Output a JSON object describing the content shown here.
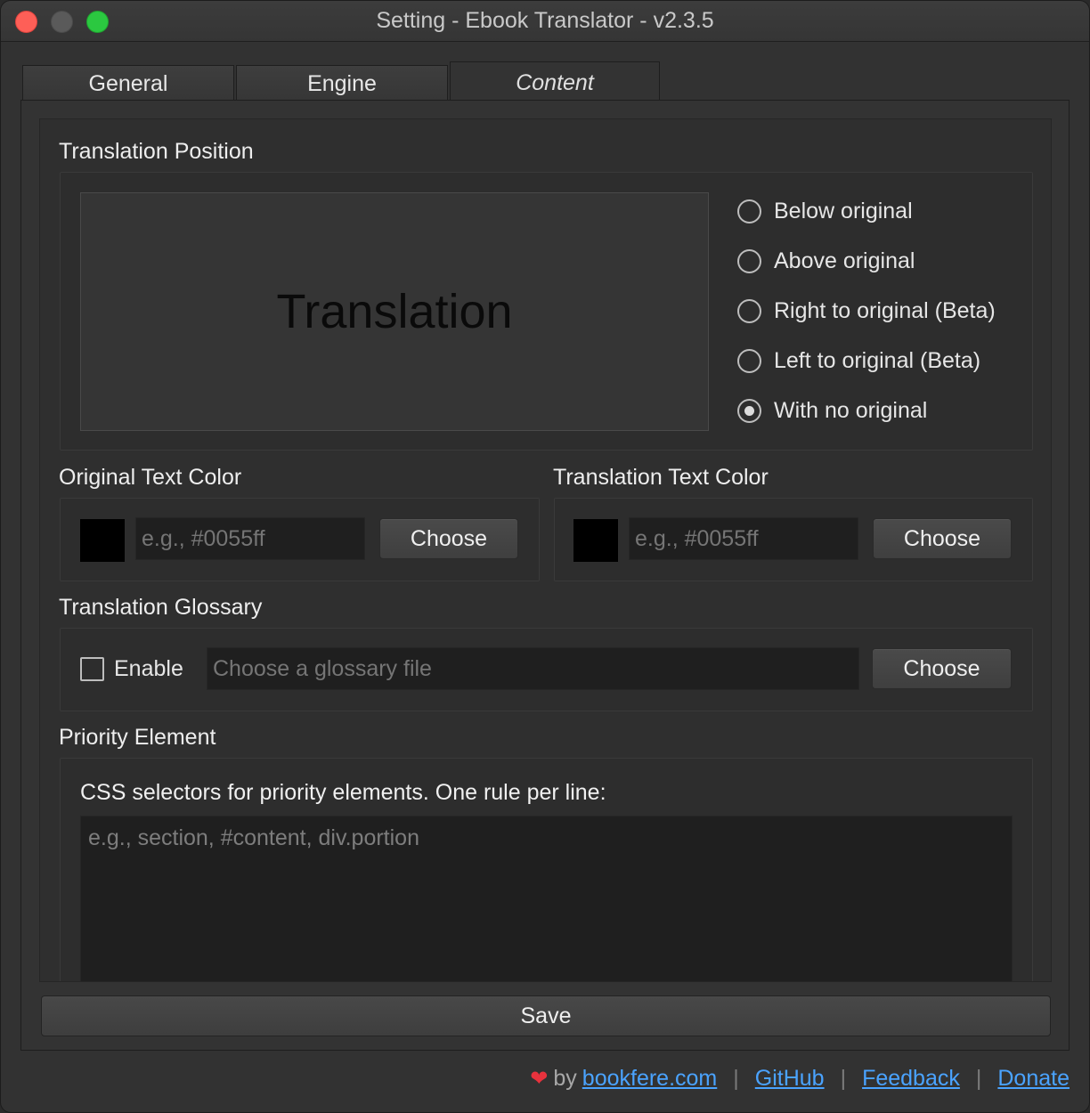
{
  "window": {
    "title": "Setting - Ebook Translator - v2.3.5"
  },
  "tabs": [
    {
      "label": "General",
      "active": false
    },
    {
      "label": "Engine",
      "active": false
    },
    {
      "label": "Content",
      "active": true
    }
  ],
  "translation_position": {
    "heading": "Translation Position",
    "preview_text": "Translation",
    "options": [
      {
        "label": "Below original",
        "checked": false
      },
      {
        "label": "Above original",
        "checked": false
      },
      {
        "label": "Right to original (Beta)",
        "checked": false
      },
      {
        "label": "Left to original (Beta)",
        "checked": false
      },
      {
        "label": "With no original",
        "checked": true
      }
    ]
  },
  "original_color": {
    "heading": "Original Text Color",
    "swatch": "#000000",
    "value": "",
    "placeholder": "e.g., #0055ff",
    "button": "Choose"
  },
  "translation_color": {
    "heading": "Translation Text Color",
    "swatch": "#000000",
    "value": "",
    "placeholder": "e.g., #0055ff",
    "button": "Choose"
  },
  "glossary": {
    "heading": "Translation Glossary",
    "enable_label": "Enable",
    "enabled": false,
    "placeholder": "Choose a glossary file",
    "button": "Choose"
  },
  "priority": {
    "heading": "Priority Element",
    "description": "CSS selectors for priority elements. One rule per line:",
    "placeholder": "e.g., section, #content, div.portion"
  },
  "save_label": "Save",
  "footer": {
    "by": "by",
    "links": [
      "bookfere.com",
      "GitHub",
      "Feedback",
      "Donate"
    ],
    "separator": "|"
  },
  "colors": {
    "accent_link": "#4aa3ff",
    "heart": "#e8323d",
    "close": "#fe5f57",
    "maximize": "#2bc840"
  }
}
